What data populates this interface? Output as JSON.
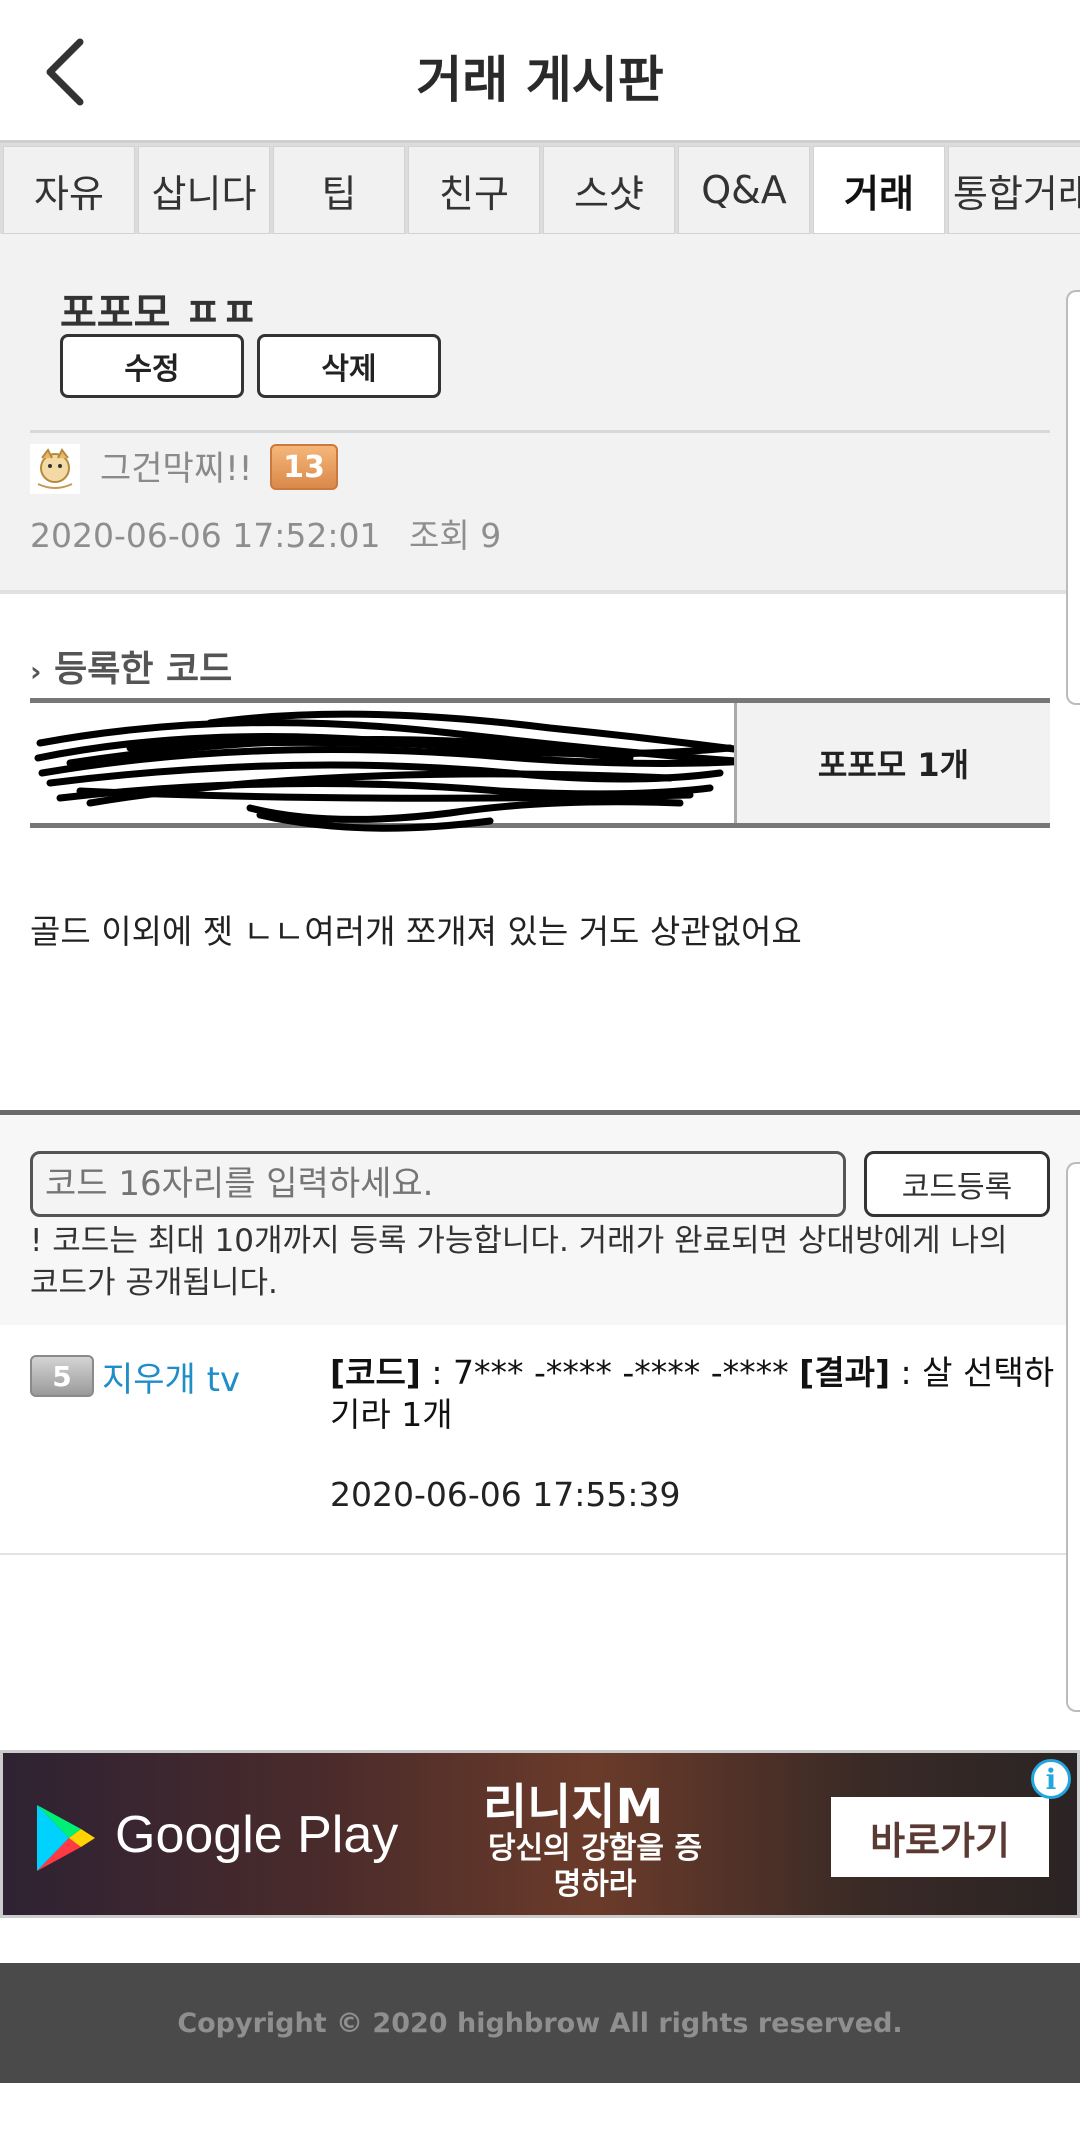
{
  "header": {
    "title": "거래 게시판"
  },
  "tabs": [
    {
      "label": "자유"
    },
    {
      "label": "삽니다"
    },
    {
      "label": "팁"
    },
    {
      "label": "친구"
    },
    {
      "label": "스샷"
    },
    {
      "label": "Q&A"
    },
    {
      "label": "거래"
    },
    {
      "label": "통합거래"
    }
  ],
  "post": {
    "title": "포포모 ㅍㅍ",
    "edit_label": "수정",
    "delete_label": "삭제",
    "author": "그건막찌!!",
    "author_level": "13",
    "datetime": "2020-06-06 17:52:01",
    "views": "조회 9",
    "section_label": "등록한 코드",
    "code_item": "포포모 1개",
    "body": "골드 이외에 젯 ㄴㄴ여러개 쪼개져 있는 거도 상관없어요"
  },
  "register": {
    "placeholder": "코드 16자리를 입력하세요.",
    "button_label": "코드등록",
    "notice": "! 코드는 최대 10개까지 등록 가능합니다. 거래가 완료되면 상대방에게 나의 코드가 공개됩니다."
  },
  "comment": {
    "level": "5",
    "user": "지우개 tv",
    "code_label": "[코드]",
    "code_value": " : 7*** -**** -**** -**** ",
    "result_label": "[결과]",
    "result_value": " : 살  선택하기라 1개",
    "datetime": "2020-06-06 17:55:39"
  },
  "ad": {
    "store": "Google Play",
    "game_title": "리니지M",
    "game_sub": "당신의 강함을 증명하라",
    "cta": "바로가기",
    "info": "i"
  },
  "footer": {
    "text": "Copyright © 2020 highbrow All rights reserved."
  }
}
